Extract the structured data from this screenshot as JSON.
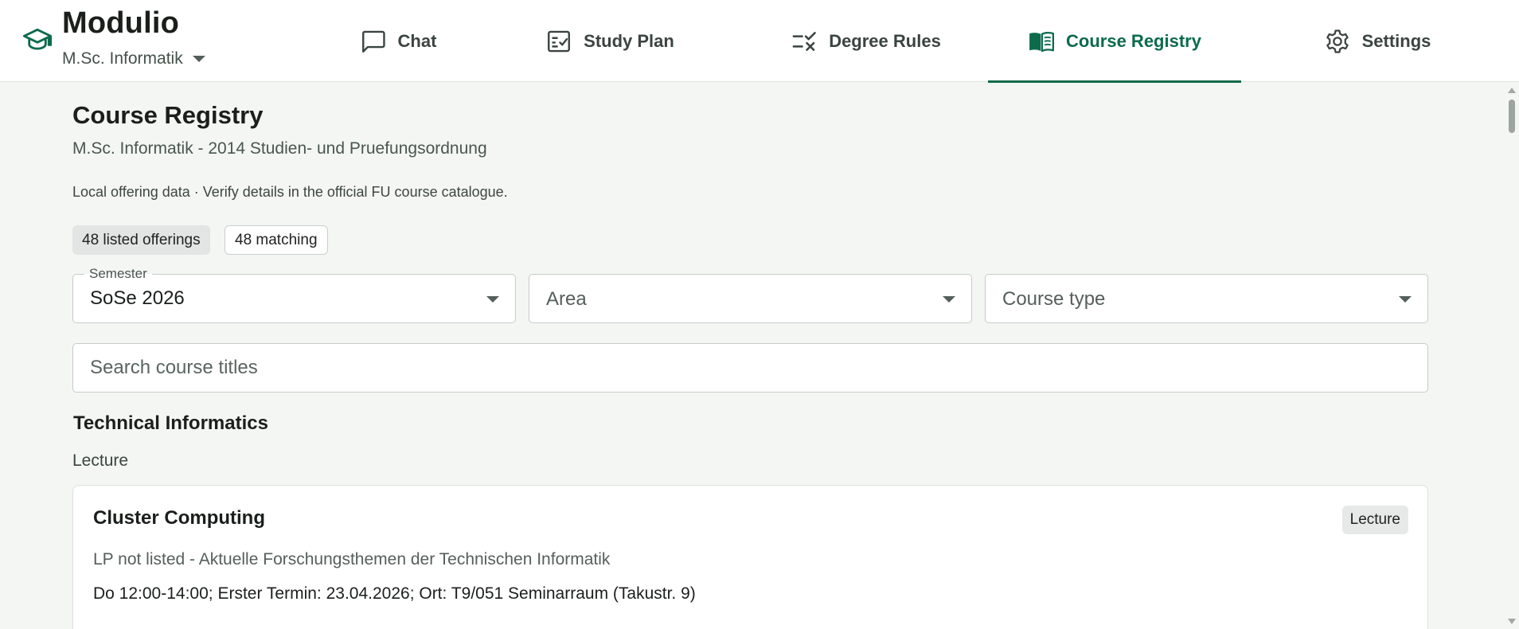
{
  "app": {
    "name": "Modulio",
    "program": "M.Sc. Informatik"
  },
  "tabs": [
    {
      "label": "Chat",
      "icon": "chat-bubble-icon",
      "active": false
    },
    {
      "label": "Study Plan",
      "icon": "checklist-icon",
      "active": false
    },
    {
      "label": "Degree Rules",
      "icon": "rules-icon",
      "active": false
    },
    {
      "label": "Course Registry",
      "icon": "book-icon",
      "active": true
    },
    {
      "label": "Settings",
      "icon": "gear-icon",
      "active": false
    }
  ],
  "page": {
    "title": "Course Registry",
    "subtitle": "M.Sc. Informatik - 2014 Studien- und Pruefungsordnung",
    "notice": "Local offering data · Verify details in the official FU course catalogue."
  },
  "counts": {
    "listed": "48 listed offerings",
    "matching": "48 matching"
  },
  "filters": {
    "semester": {
      "label": "Semester",
      "value": "SoSe 2026"
    },
    "area": {
      "placeholder": "Area"
    },
    "course_type": {
      "placeholder": "Course type"
    }
  },
  "search": {
    "placeholder": "Search course titles"
  },
  "sections": [
    {
      "title": "Technical Informatics",
      "groups": [
        {
          "label": "Lecture",
          "courses": [
            {
              "title": "Cluster Computing",
              "badge": "Lecture",
              "meta": "LP not listed - Aktuelle Forschungsthemen der Technischen Informatik",
              "schedule": "Do 12:00-14:00; Erster Termin: 23.04.2026; Ort: T9/051 Seminarraum (Takustr. 9)"
            }
          ]
        }
      ]
    }
  ],
  "colors": {
    "accent": "#0c6b4a",
    "background": "#f4f6f4",
    "surface": "#ffffff",
    "text": "#1b1f1c",
    "muted": "#555f5a"
  }
}
